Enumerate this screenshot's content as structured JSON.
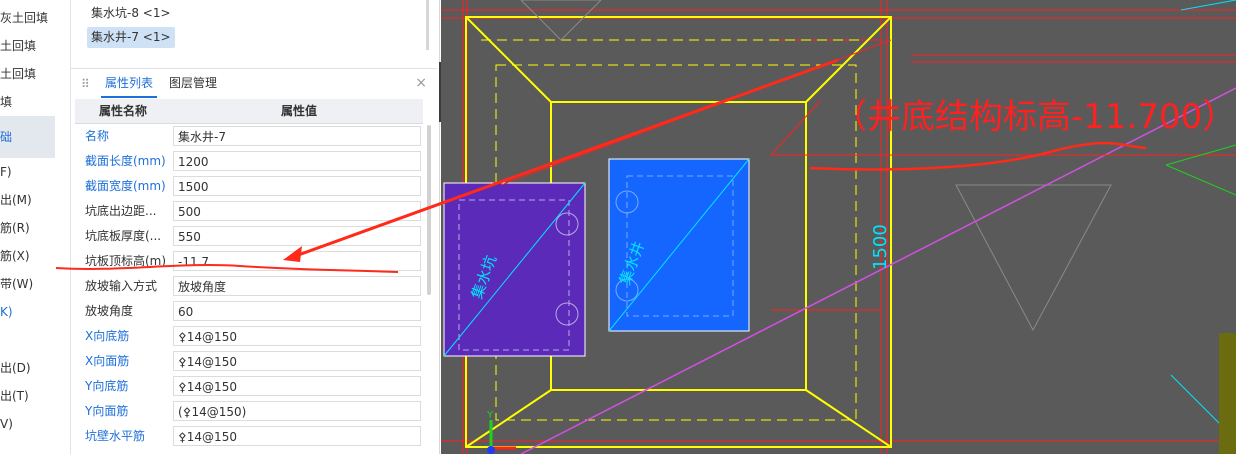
{
  "left_menu": {
    "items": [
      {
        "label": "灰土回填"
      },
      {
        "label": "土回填"
      },
      {
        "label": "土回填"
      },
      {
        "label": "填"
      },
      {
        "label": "础"
      },
      {
        "label": "F)"
      },
      {
        "label": "出(M)"
      },
      {
        "label": "筋(R)"
      },
      {
        "label": "筋(X)"
      },
      {
        "label": "带(W)"
      },
      {
        "label": "K)"
      },
      {
        "label": "出(D)"
      },
      {
        "label": "出(T)"
      },
      {
        "label": "V)"
      }
    ]
  },
  "tree": {
    "items": [
      {
        "label": "集水坑-8 <1>"
      },
      {
        "label": "集水井-7 <1>"
      }
    ]
  },
  "panel": {
    "tabs": [
      {
        "label": "属性列表"
      },
      {
        "label": "图层管理"
      }
    ],
    "close": "×",
    "handle": "⠿"
  },
  "properties": {
    "header_name": "属性名称",
    "header_value": "属性值",
    "rows": [
      {
        "name": "名称",
        "value": "集水井-7"
      },
      {
        "name": "截面长度(mm)",
        "value": "1200"
      },
      {
        "name": "截面宽度(mm)",
        "value": "1500"
      },
      {
        "name": "坑底出边距...",
        "value": "500"
      },
      {
        "name": "坑底板厚度(...",
        "value": "550"
      },
      {
        "name": "坑板顶标高(m)",
        "value": "-11.7"
      },
      {
        "name": "放坡输入方式",
        "value": "放坡角度"
      },
      {
        "name": "放坡角度",
        "value": "60"
      },
      {
        "name": "X向底筋",
        "value": "⚴14@150"
      },
      {
        "name": "X向面筋",
        "value": "⚴14@150"
      },
      {
        "name": "Y向底筋",
        "value": "⚴14@150"
      },
      {
        "name": "Y向面筋",
        "value": "(⚴14@150)"
      },
      {
        "name": "坑壁水平筋",
        "value": "⚴14@150"
      }
    ]
  },
  "collapse_icon": "‹",
  "cad": {
    "annotation": "（井底结构标高-11.700）",
    "dim_1500": "1500",
    "pit_label": "集水坑",
    "well_label": "集水井",
    "axis_y": "Y",
    "colors": {
      "background": "#5a5a5a",
      "outline": "#ffff00",
      "dim_red": "#ff2020",
      "cyan": "#00e5ff",
      "magenta": "#d050e0",
      "purple_fill": "#5b2ab8",
      "blue_fill": "#1466ff",
      "green": "#20d020"
    }
  },
  "overlay": {
    "arrow_color": "#ff2a1a"
  }
}
